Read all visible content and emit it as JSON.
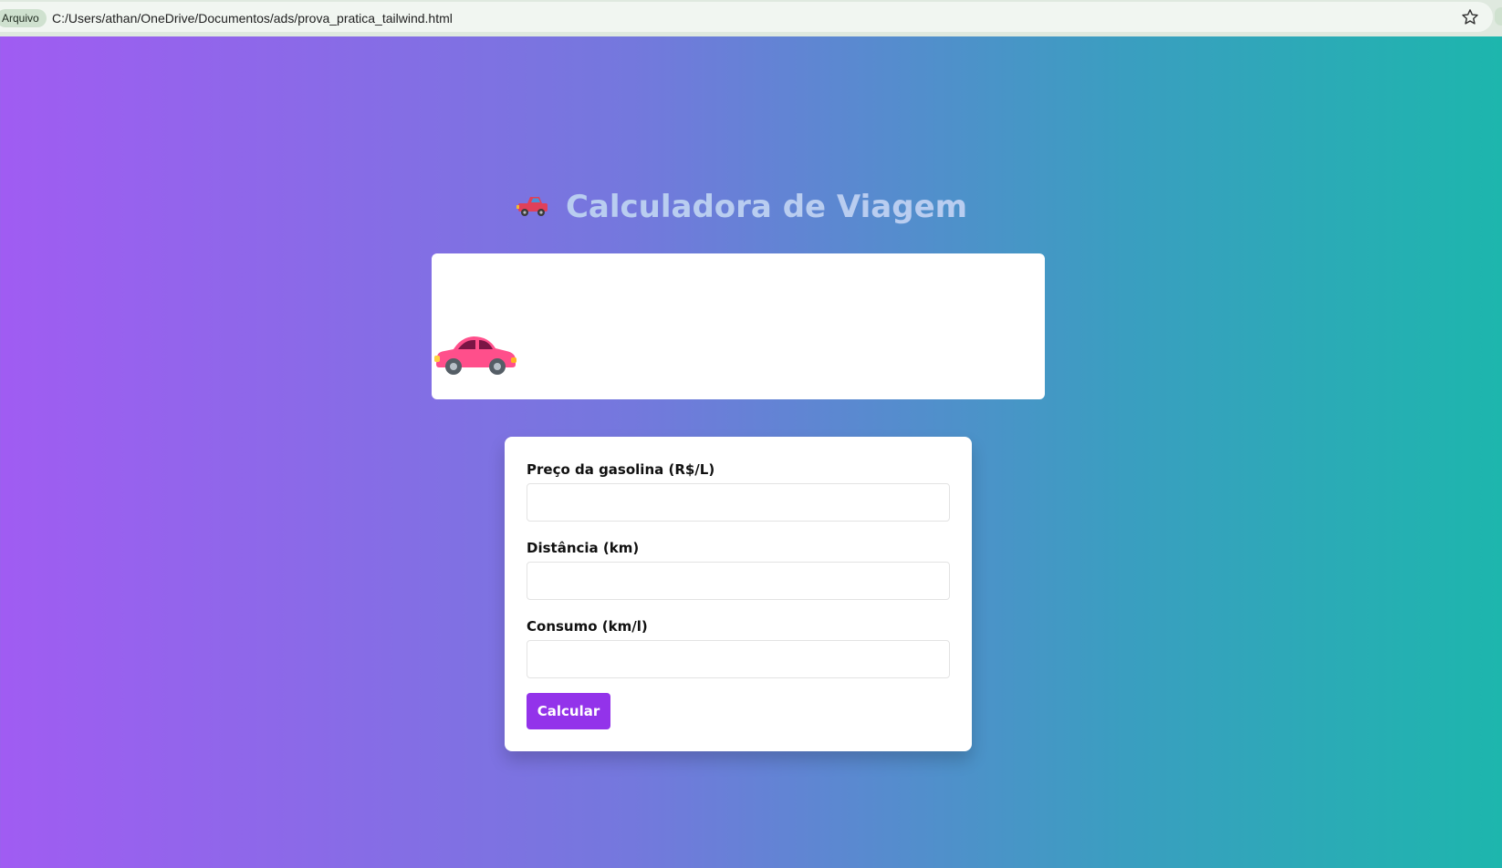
{
  "browser": {
    "chip_label": "Arquivo",
    "url": "C:/Users/athan/OneDrive/Documentos/ads/prova_pratica_tailwind.html",
    "bookmark_icon": "star-icon"
  },
  "page": {
    "title": "Calculadora de Viagem",
    "title_icon": "pickup-truck-icon",
    "animation_icon": "car-icon"
  },
  "form": {
    "fields": [
      {
        "label": "Preço da gasolina (R$/L)",
        "value": "",
        "placeholder": ""
      },
      {
        "label": "Distância (km)",
        "value": "",
        "placeholder": ""
      },
      {
        "label": "Consumo (km/l)",
        "value": "",
        "placeholder": ""
      }
    ],
    "submit_label": "Calcular"
  },
  "colors": {
    "gradient_start": "#a05cf2",
    "gradient_end": "#1db6ad",
    "button": "#9333ea",
    "title": "#b9cdf0",
    "car_body": "#ff4f8b"
  }
}
